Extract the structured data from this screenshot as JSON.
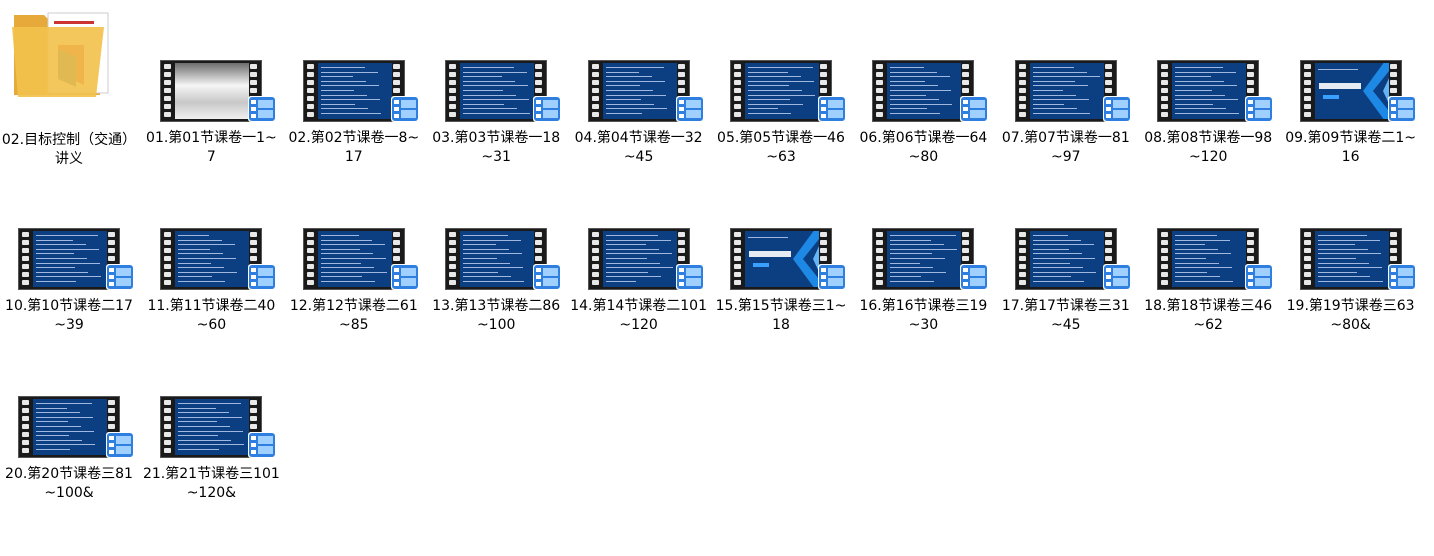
{
  "items": [
    {
      "type": "folder",
      "label": "02.目标控制（交通）讲义"
    },
    {
      "type": "video",
      "thumb": "blank",
      "label": "01.第01节课卷一1~7"
    },
    {
      "type": "video",
      "thumb": "text",
      "label": "02.第02节课卷一8~17"
    },
    {
      "type": "video",
      "thumb": "text",
      "label": "03.第03节课卷一18~31"
    },
    {
      "type": "video",
      "thumb": "text",
      "label": "04.第04节课卷一32~45"
    },
    {
      "type": "video",
      "thumb": "text",
      "label": "05.第05节课卷一46~63"
    },
    {
      "type": "video",
      "thumb": "text",
      "label": "06.第06节课卷一64~80"
    },
    {
      "type": "video",
      "thumb": "text",
      "label": "07.第07节课卷一81~97"
    },
    {
      "type": "video",
      "thumb": "text",
      "label": "08.第08节课卷一98~120"
    },
    {
      "type": "video",
      "thumb": "title",
      "label": "09.第09节课卷二1~16"
    },
    {
      "type": "video",
      "thumb": "text",
      "label": "10.第10节课卷二17~39"
    },
    {
      "type": "video",
      "thumb": "text",
      "label": "11.第11节课卷二40~60"
    },
    {
      "type": "video",
      "thumb": "text",
      "label": "12.第12节课卷二61~85"
    },
    {
      "type": "video",
      "thumb": "text",
      "label": "13.第13节课卷二86~100"
    },
    {
      "type": "video",
      "thumb": "text",
      "label": "14.第14节课卷二101~120"
    },
    {
      "type": "video",
      "thumb": "title",
      "label": "15.第15节课卷三1~18"
    },
    {
      "type": "video",
      "thumb": "text",
      "label": "16.第16节课卷三19~30"
    },
    {
      "type": "video",
      "thumb": "text",
      "label": "17.第17节课卷三31~45"
    },
    {
      "type": "video",
      "thumb": "text",
      "label": "18.第18节课卷三46~62"
    },
    {
      "type": "video",
      "thumb": "text",
      "label": "19.第19节课卷三63~80&"
    },
    {
      "type": "video",
      "thumb": "text",
      "label": "20.第20节课卷三81~100&"
    },
    {
      "type": "video",
      "thumb": "text",
      "label": "21.第21节课卷三101~120&"
    }
  ],
  "colors": {
    "slide_blue": "#0c3e82",
    "badge_blue": "#2f7fe0",
    "folder_yellow": "#f2c24d"
  }
}
